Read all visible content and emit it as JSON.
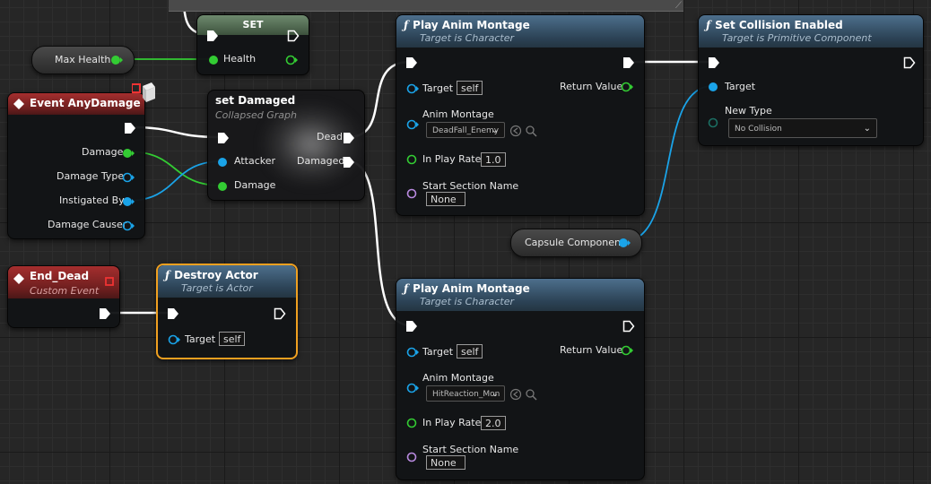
{
  "nodes": {
    "set": {
      "title": "SET",
      "pin_health": "Health"
    },
    "max_health": {
      "label": "Max Health"
    },
    "event_any_damage": {
      "title": "Event AnyDamage",
      "pins": {
        "damage": "Damage",
        "damage_type": "Damage Type",
        "instigated_by": "Instigated By",
        "damage_causer": "Damage Causer"
      }
    },
    "set_damaged": {
      "title": "set Damaged",
      "subtitle": "Collapsed Graph",
      "pins": {
        "attacker": "Attacker",
        "damage": "Damage",
        "dead": "Dead",
        "damaged": "Damaged"
      }
    },
    "play_montage_1": {
      "title": "Play Anim Montage",
      "subtitle": "Target is Character",
      "target_label": "Target",
      "target_value": "self",
      "return_label": "Return Value",
      "montage_label": "Anim Montage",
      "montage_value": "DeadFall_Enemy",
      "rate_label": "In Play Rate",
      "rate_value": "1.0",
      "section_label": "Start Section Name",
      "section_value": "None"
    },
    "set_collision": {
      "title": "Set Collision Enabled",
      "subtitle": "Target is Primitive Component",
      "target_label": "Target",
      "new_type_label": "New Type",
      "new_type_value": "No Collision"
    },
    "capsule": {
      "label": "Capsule Component"
    },
    "end_dead": {
      "title": "End_Dead",
      "subtitle": "Custom Event"
    },
    "destroy_actor": {
      "title": "Destroy Actor",
      "subtitle": "Target is Actor",
      "target_label": "Target",
      "target_value": "self"
    },
    "play_montage_2": {
      "title": "Play Anim Montage",
      "subtitle": "Target is Character",
      "target_label": "Target",
      "target_value": "self",
      "return_label": "Return Value",
      "montage_label": "Anim Montage",
      "montage_value": "HitReaction_Mon",
      "rate_label": "In Play Rate",
      "rate_value": "2.0",
      "section_label": "Start Section Name",
      "section_value": "None"
    }
  },
  "icons": {
    "function": "ƒ",
    "dropdown": "chevron-down-icon",
    "browse": "browse-icon",
    "search": "search-icon"
  },
  "colors": {
    "exec": "#ffffff",
    "float": "#33cc33",
    "object": "#1aa3e8",
    "name": "#b98ae0",
    "fn_header": "#3c5a72",
    "event_header": "#8c2828",
    "selected": "#f0a020"
  }
}
